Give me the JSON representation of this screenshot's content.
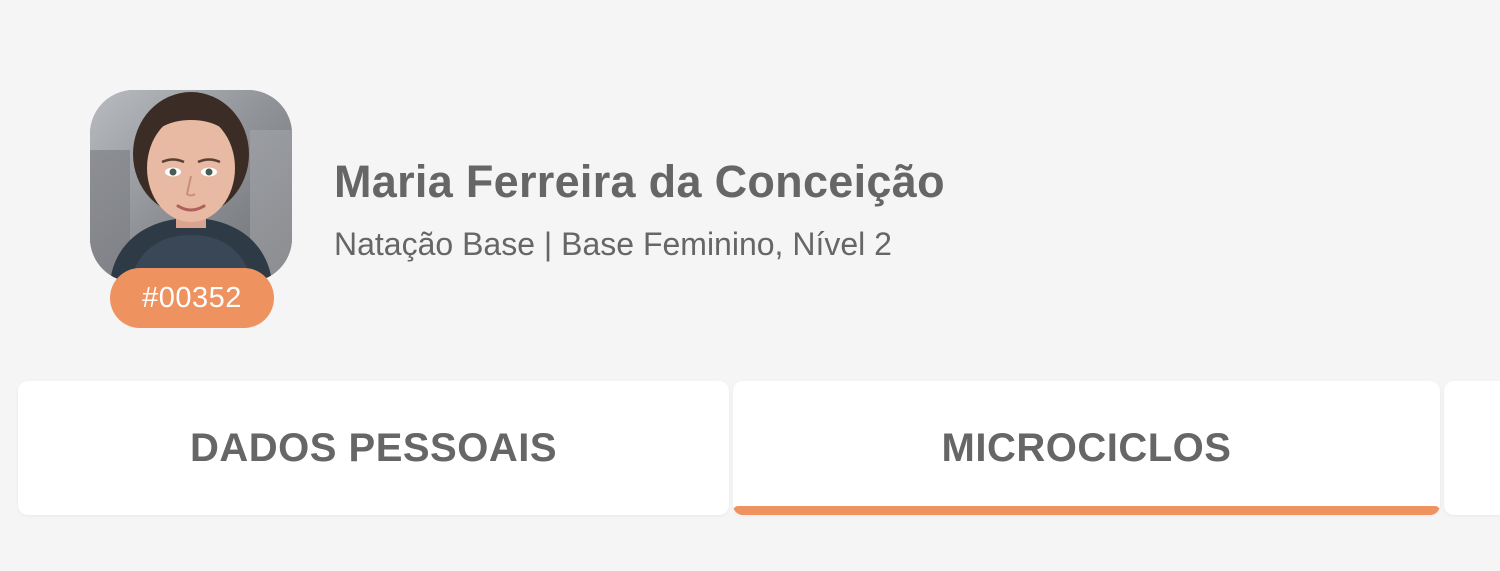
{
  "profile": {
    "name": "Maria Ferreira da Conceição",
    "subtitle": "Natação Base | Base Feminino, Nível 2",
    "athlete_id": "#00352",
    "badge_color": "#ee9260"
  },
  "tabs": [
    {
      "label": "DADOS PESSOAIS",
      "active": false
    },
    {
      "label": "MICROCICLOS",
      "active": true
    },
    {
      "label": "",
      "active": false
    }
  ],
  "colors": {
    "background": "#f5f5f5",
    "text": "#666666",
    "accent": "#ee9260"
  }
}
